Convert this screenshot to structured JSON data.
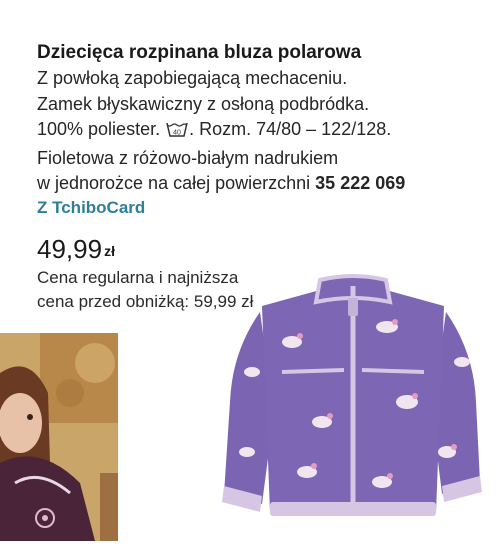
{
  "product": {
    "title": "Dziecięca rozpinana bluza polarowa",
    "desc_line1": "Z powłoką zapobiegającą mechaceniu.",
    "desc_line2": "Zamek błyskawiczny z osłoną podbródka.",
    "material": "100% poliester.",
    "wash_icon": "wash-40-icon",
    "wash_temp": "40",
    "sizes": ". Rozm. 74/80 – 122/128.",
    "color_line1": "Fioletowa z różowo-białym nadrukiem",
    "color_line2": "w jednorożce na całej powierzchni",
    "article_number": "35 222 069",
    "card_note": "Z TchiboCard"
  },
  "price": {
    "value": "49,99",
    "currency": "zł",
    "note_line1": "Cena regularna i najniższa",
    "note_line2": "cena przed obniżką: 59,99 zł"
  },
  "colors": {
    "accent": "#2f7e9c",
    "jacket_purple": "#7d66b4",
    "jacket_trim": "#d6c6e4"
  }
}
